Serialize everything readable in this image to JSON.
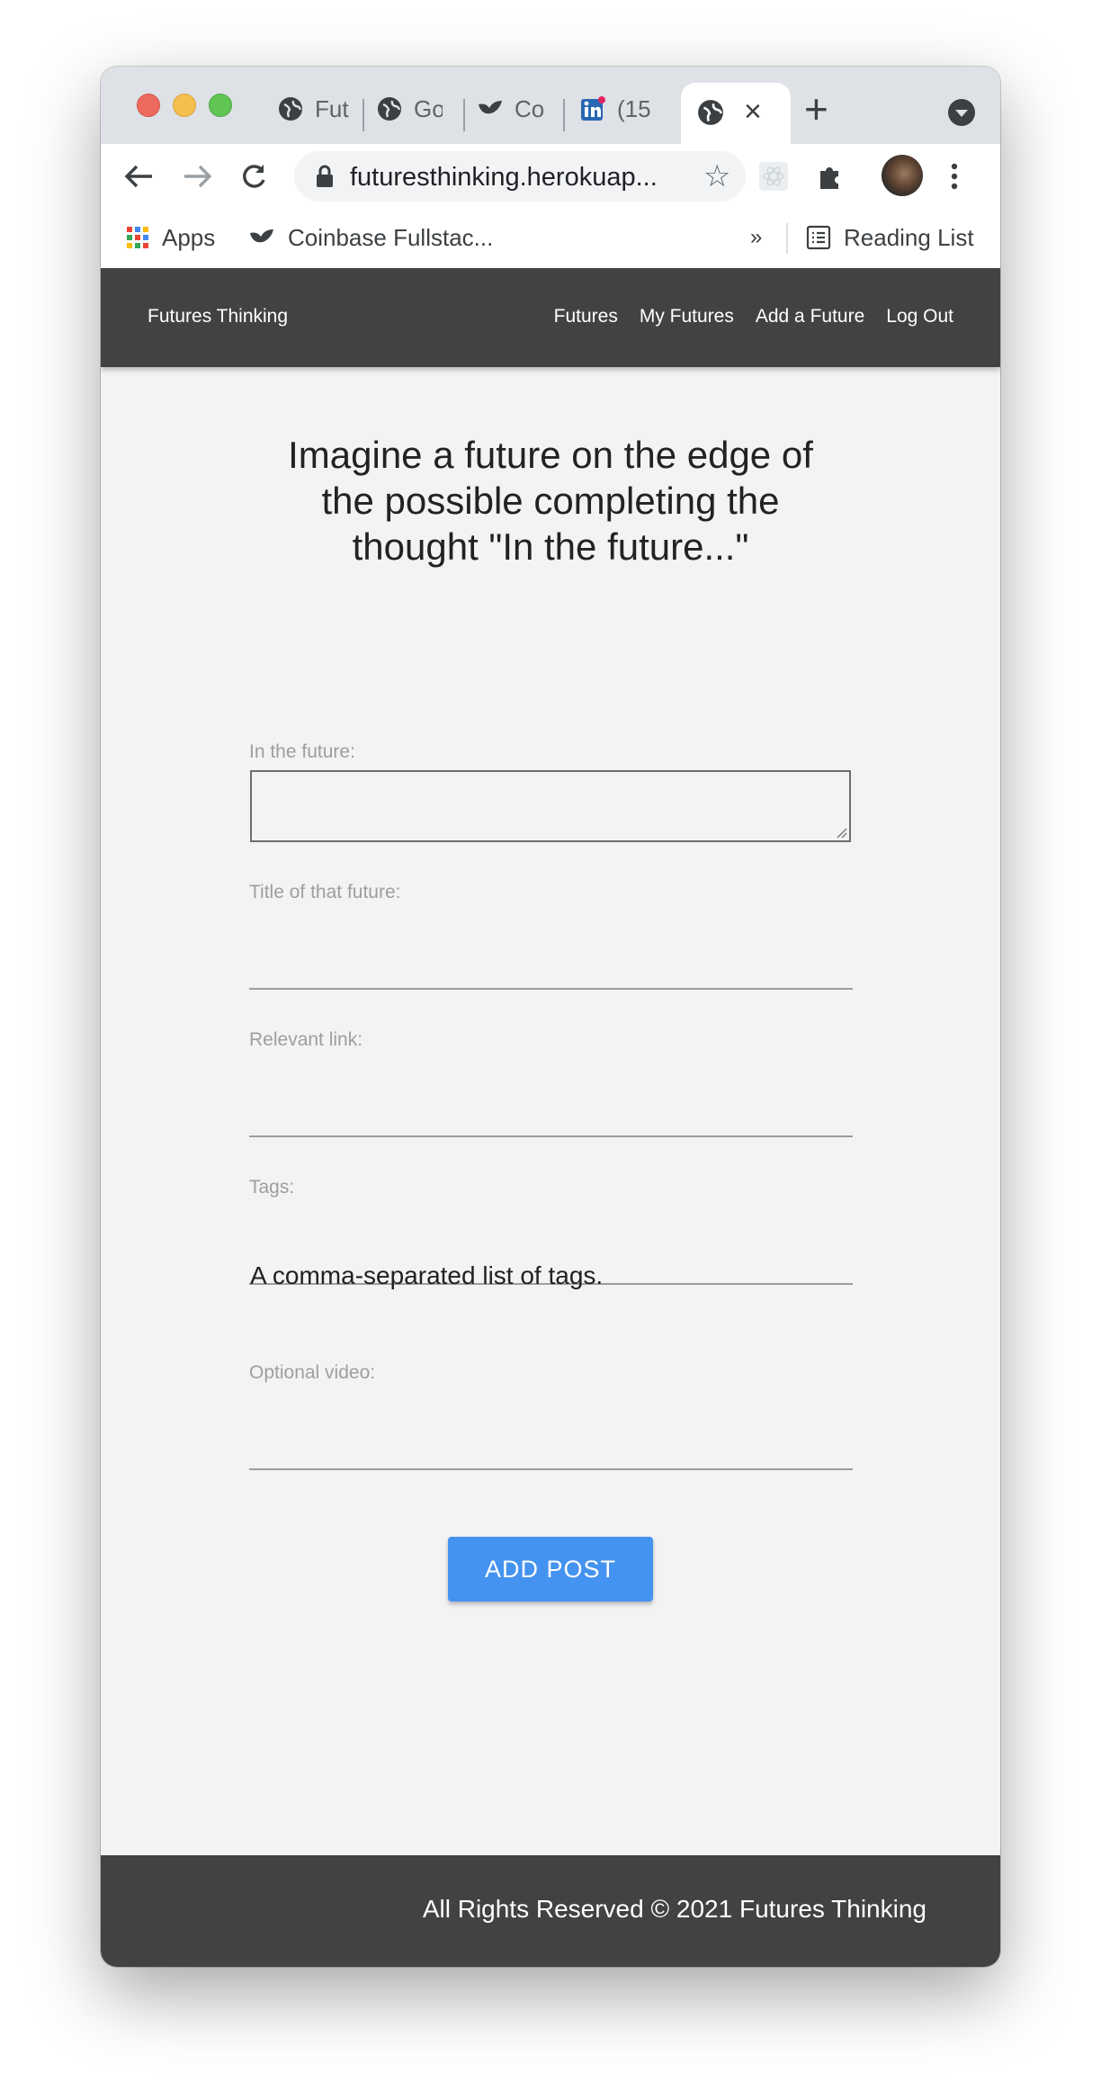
{
  "browser": {
    "tabs": [
      {
        "label": "Fut",
        "icon": "globe-icon"
      },
      {
        "label": "Go",
        "icon": "globe-icon"
      },
      {
        "label": "Co",
        "icon": "coinbase-bird-icon"
      },
      {
        "label": "(15",
        "icon": "linkedin-icon"
      },
      {
        "label": "",
        "icon": "globe-icon",
        "active": true
      }
    ],
    "url": "futuresthinking.herokuap...",
    "bookmarks": {
      "apps_label": "Apps",
      "coinbase_label": "Coinbase Fullstac...",
      "overflow_label": "»",
      "reading_list_label": "Reading List"
    }
  },
  "app": {
    "brand": "Futures Thinking",
    "nav": [
      "Futures",
      "My Futures",
      "Add a Future",
      "Log Out"
    ],
    "headline": "Imagine a future on the edge of the possible completing the thought \"In the future...\"",
    "form": {
      "future_label": "In the future:",
      "future_value": "",
      "title_label": "Title of that future:",
      "title_value": "",
      "link_label": "Relevant link:",
      "link_value": "",
      "tags_label": "Tags:",
      "tags_value": "",
      "tags_helper": "A comma-separated list of tags.",
      "video_label": "Optional video:",
      "video_value": "",
      "submit_label": "ADD POST"
    },
    "footer": "All Rights Reserved © 2021 Futures Thinking"
  },
  "colors": {
    "navbar": "#424242",
    "page_bg": "#f3f3f4",
    "button": "#4593f0"
  }
}
